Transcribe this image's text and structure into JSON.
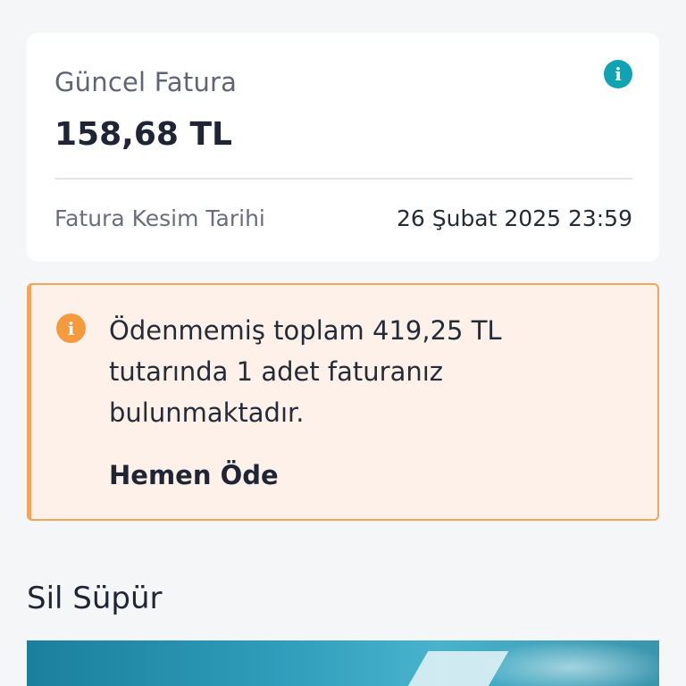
{
  "invoice": {
    "title": "Güncel Fatura",
    "amount": "158,68 TL",
    "info_icon": "info-icon",
    "cut_date_label": "Fatura Kesim Tarihi",
    "cut_date_value": "26 Şubat 2025 23:59"
  },
  "warning": {
    "icon": "info-icon",
    "message": "Ödenmemiş toplam 419,25 TL tutarında 1 adet faturanız bulunmaktadır.",
    "action_label": "Hemen Öde"
  },
  "section": {
    "title": "Sil Süpür"
  },
  "colors": {
    "accent": "#0fa3b3",
    "warning": "#f59a3d",
    "warning_bg": "#fdf1ea"
  }
}
